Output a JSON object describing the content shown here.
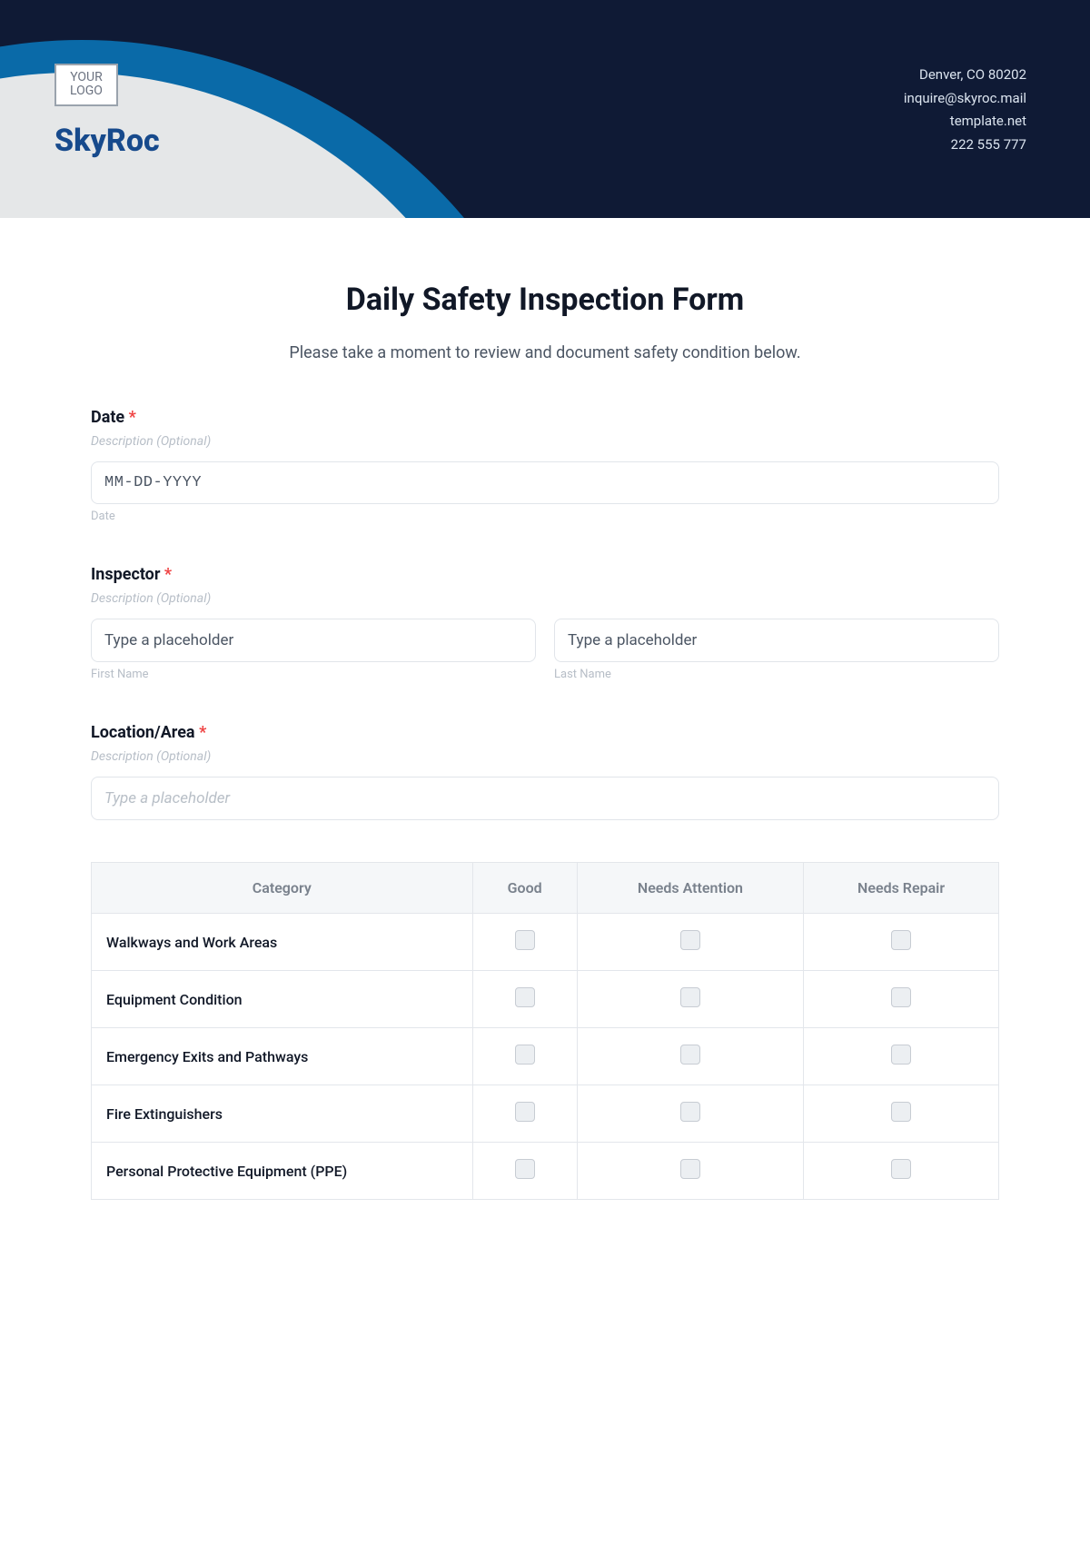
{
  "header": {
    "logo_line1": "YOUR",
    "logo_line2": "LOGO",
    "brand": "SkyRoc",
    "contact": {
      "address": "Denver, CO 80202",
      "email": "inquire@skyroc.mail",
      "website": "template.net",
      "phone": "222 555 777"
    }
  },
  "form": {
    "title": "Daily Safety Inspection Form",
    "subtitle": "Please take a moment to review and document safety condition below.",
    "required_mark": "*",
    "date": {
      "label": "Date",
      "desc": "Description (Optional)",
      "placeholder": "MM-DD-YYYY",
      "sublabel": "Date"
    },
    "inspector": {
      "label": "Inspector",
      "desc": "Description (Optional)",
      "first_placeholder": "Type a placeholder",
      "first_sublabel": "First Name",
      "last_placeholder": "Type a placeholder",
      "last_sublabel": "Last Name"
    },
    "location": {
      "label": "Location/Area",
      "desc": "Description (Optional)",
      "placeholder": "Type a placeholder"
    },
    "checklist": {
      "headers": [
        "Category",
        "Good",
        "Needs Attention",
        "Needs Repair"
      ],
      "rows": [
        "Walkways and Work Areas",
        "Equipment Condition",
        "Emergency Exits and Pathways",
        "Fire Extinguishers",
        "Personal Protective Equipment (PPE)"
      ]
    }
  }
}
